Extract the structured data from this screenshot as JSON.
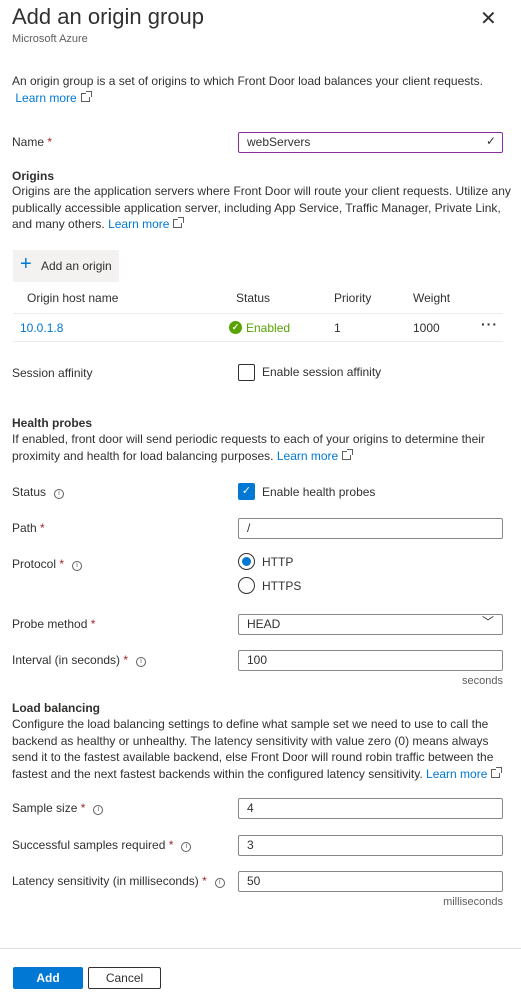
{
  "header": {
    "title": "Add an origin group",
    "subtitle": "Microsoft Azure",
    "close_icon": "close-icon"
  },
  "intro": {
    "text": "An origin group is a set of origins to which Front Door load balances your client requests.",
    "learn_more": "Learn more"
  },
  "name": {
    "label": "Name",
    "value": "webServers"
  },
  "origins": {
    "heading": "Origins",
    "text": "Origins are the application servers where Front Door will route your client requests. Utilize any publically accessible application server, including App Service, Traffic Manager, Private Link, and many others.",
    "learn_more": "Learn more",
    "add_label": "Add an origin",
    "columns": [
      "Origin host name",
      "Status",
      "Priority",
      "Weight"
    ],
    "rows": [
      {
        "host": "10.0.1.8",
        "status": "Enabled",
        "priority": "1",
        "weight": "1000"
      }
    ]
  },
  "session": {
    "label": "Session affinity",
    "checkbox_label": "Enable session affinity",
    "checked": false
  },
  "health": {
    "heading": "Health probes",
    "text": "If enabled, front door will send periodic requests to each of your origins to determine their proximity and health for load balancing purposes.",
    "learn_more": "Learn more",
    "status_label": "Status",
    "status_checkbox": "Enable health probes",
    "status_checked": true,
    "path_label": "Path",
    "path_value": "/",
    "protocol_label": "Protocol",
    "protocol_options": [
      "HTTP",
      "HTTPS"
    ],
    "protocol_selected": "HTTP",
    "method_label": "Probe method",
    "method_value": "HEAD",
    "interval_label": "Interval (in seconds)",
    "interval_value": "100",
    "interval_unit": "seconds"
  },
  "load": {
    "heading": "Load balancing",
    "text": "Configure the load balancing settings to define what sample set we need to use to call the backend as healthy or unhealthy. The latency sensitivity with value zero (0) means always send it to the fastest available backend, else Front Door will round robin traffic between the fastest and the next fastest backends within the configured latency sensitivity.",
    "learn_more": "Learn more",
    "sample_label": "Sample size",
    "sample_value": "4",
    "success_label": "Successful samples required",
    "success_value": "3",
    "latency_label": "Latency sensitivity (in milliseconds)",
    "latency_value": "50",
    "latency_unit": "milliseconds"
  },
  "footer": {
    "add": "Add",
    "cancel": "Cancel"
  },
  "colors": {
    "accent": "#0078d4",
    "valid_border": "#8a2da5",
    "enabled": "#57a300"
  }
}
